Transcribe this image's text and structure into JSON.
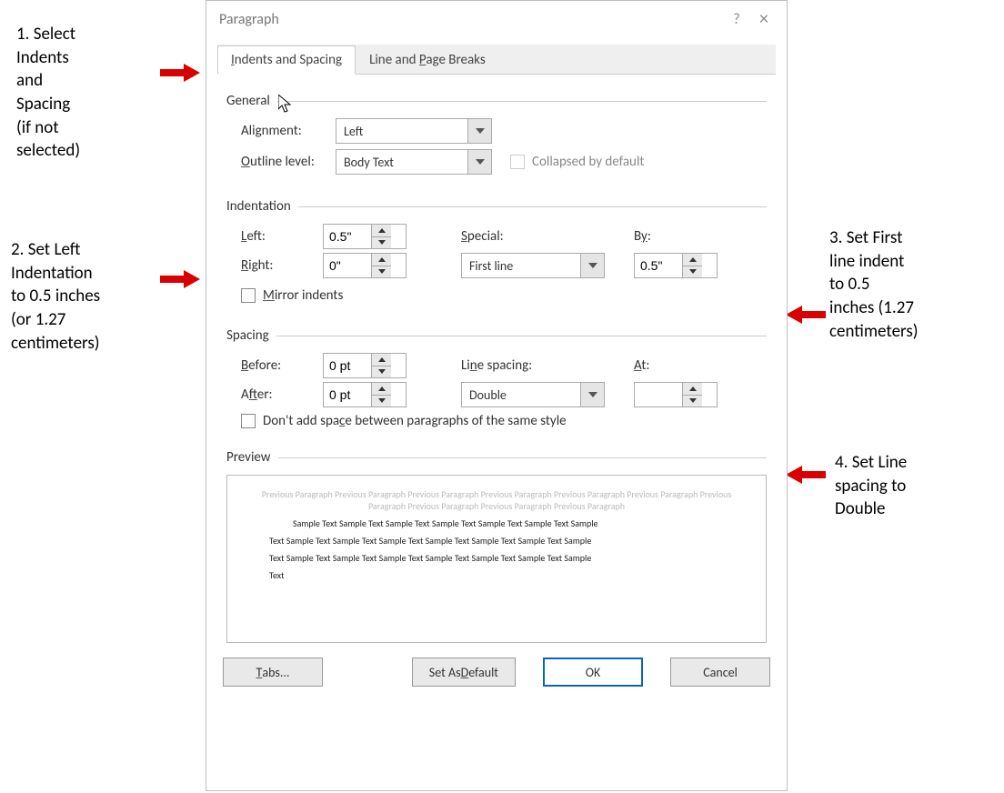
{
  "annotations": {
    "a1": "1. Select\nIndents\nand\nSpacing\n(if not\nselected)",
    "a2": "2. Set Left\nIndentation\nto 0.5 inches\n(or 1.27\ncentimeters)",
    "a3": "3. Set First\nline indent\nto 0.5\ninches (1.27\ncentimeters)",
    "a4": "4. Set Line\nspacing to\nDouble"
  },
  "dialog": {
    "title": "Paragraph",
    "help": "?",
    "close": "×",
    "tabs": {
      "indents": "Indents and Spacing",
      "pagebreaks": "Line and Page Breaks"
    },
    "general": {
      "header": "General",
      "alignment_label": "Alignment:",
      "alignment_value": "Left",
      "outline_label": "Outline level:",
      "outline_value": "Body Text",
      "collapsed_label": "Collapsed by default"
    },
    "indentation": {
      "header": "Indentation",
      "left_label": "Left:",
      "left_value": "0.5\"",
      "right_label": "Right:",
      "right_value": "0\"",
      "special_label": "Special:",
      "special_value": "First line",
      "by_label": "By:",
      "by_value": "0.5\"",
      "mirror_label": "Mirror indents"
    },
    "spacing": {
      "header": "Spacing",
      "before_label": "Before:",
      "before_value": "0 pt",
      "after_label": "After:",
      "after_value": "0 pt",
      "line_label": "Line spacing:",
      "line_value": "Double",
      "at_label": "At:",
      "at_value": "",
      "dont_add_label": "Don't add space between paragraphs of the same style"
    },
    "preview": {
      "header": "Preview",
      "prev_text": "Previous Paragraph Previous Paragraph Previous Paragraph Previous Paragraph Previous Paragraph Previous Paragraph Previous Paragraph Previous Paragraph Previous Paragraph Previous Paragraph",
      "sample1": "Sample Text Sample Text Sample Text Sample Text Sample Text Sample Text Sample",
      "sample2": "Text Sample Text Sample Text Sample Text Sample Text Sample Text Sample Text Sample",
      "sample3": "Text Sample Text Sample Text Sample Text Sample Text Sample Text Sample Text Sample",
      "sample4": "Text"
    },
    "buttons": {
      "tabs": "Tabs...",
      "default": "Set As Default",
      "ok": "OK",
      "cancel": "Cancel"
    }
  }
}
